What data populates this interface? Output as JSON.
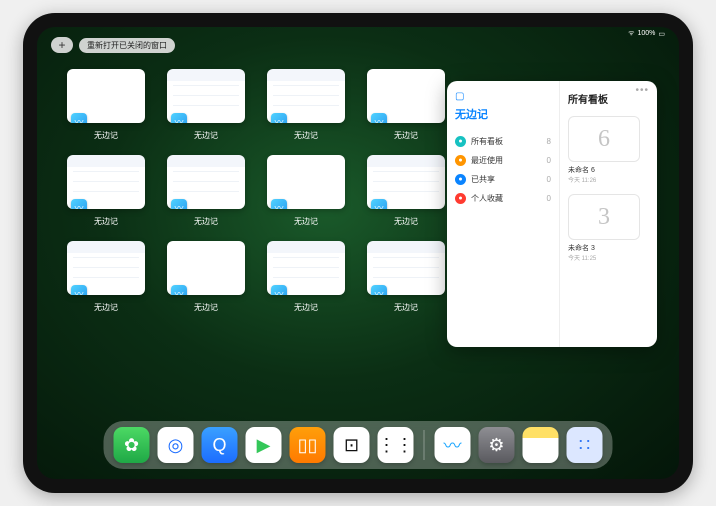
{
  "status": {
    "battery": "100%",
    "wifi": "●"
  },
  "topbar": {
    "plus": "+",
    "reopen_label": "重新打开已关闭的窗口"
  },
  "thumb_app_label": "无边记",
  "thumbs": [
    {
      "variant": "blank"
    },
    {
      "variant": "detailed"
    },
    {
      "variant": "detailed"
    },
    {
      "variant": "blank"
    },
    {
      "variant": "detailed"
    },
    {
      "variant": "detailed"
    },
    {
      "variant": "blank"
    },
    {
      "variant": "detailed"
    },
    {
      "variant": "detailed"
    },
    {
      "variant": "blank"
    },
    {
      "variant": "detailed"
    },
    {
      "variant": "detailed"
    }
  ],
  "panel": {
    "left_title": "无边记",
    "right_title": "所有看板",
    "items": [
      {
        "icon_color": "#17c1c1",
        "label": "所有看板",
        "count": "8"
      },
      {
        "icon_color": "#ff9500",
        "label": "最近使用",
        "count": "0"
      },
      {
        "icon_color": "#0a84ff",
        "label": "已共享",
        "count": "0"
      },
      {
        "icon_color": "#ff3b30",
        "label": "个人收藏",
        "count": "0"
      }
    ],
    "boards": [
      {
        "glyph": "6",
        "name": "未命名 6",
        "date": "今天 11:26"
      },
      {
        "glyph": "3",
        "name": "未命名 3",
        "date": "今天 11:25"
      }
    ]
  },
  "dock": [
    {
      "name": "wechat-icon",
      "bg": "linear-gradient(#4cd964,#1fa846)",
      "glyph": "✿"
    },
    {
      "name": "qqbrowser-icon",
      "bg": "#fff",
      "glyph": "◎",
      "fg": "#1c6dff"
    },
    {
      "name": "quark-icon",
      "bg": "linear-gradient(#3aa0ff,#1c6dff)",
      "glyph": "Q"
    },
    {
      "name": "play-icon",
      "bg": "#fff",
      "glyph": "▶",
      "fg": "#34c759"
    },
    {
      "name": "books-icon",
      "bg": "linear-gradient(#ff9f0a,#ff7a00)",
      "glyph": "▯▯"
    },
    {
      "name": "dice-icon",
      "bg": "#fff",
      "glyph": "⊡",
      "fg": "#111"
    },
    {
      "name": "nodes-icon",
      "bg": "#fff",
      "glyph": "⋮⋮",
      "fg": "#111"
    },
    {
      "name": "sep"
    },
    {
      "name": "freeform-icon",
      "bg": "#fff",
      "glyph": "〰",
      "fg": "#1ea7ff"
    },
    {
      "name": "settings-icon",
      "bg": "linear-gradient(#8e8e93,#5a5a5f)",
      "glyph": "⚙"
    },
    {
      "name": "notes-icon",
      "bg": "linear-gradient(#ffe066 0 30%,#fff 30%)",
      "glyph": " "
    },
    {
      "name": "library-icon",
      "bg": "#dce7ff",
      "glyph": "∷",
      "fg": "#3478f6"
    }
  ]
}
